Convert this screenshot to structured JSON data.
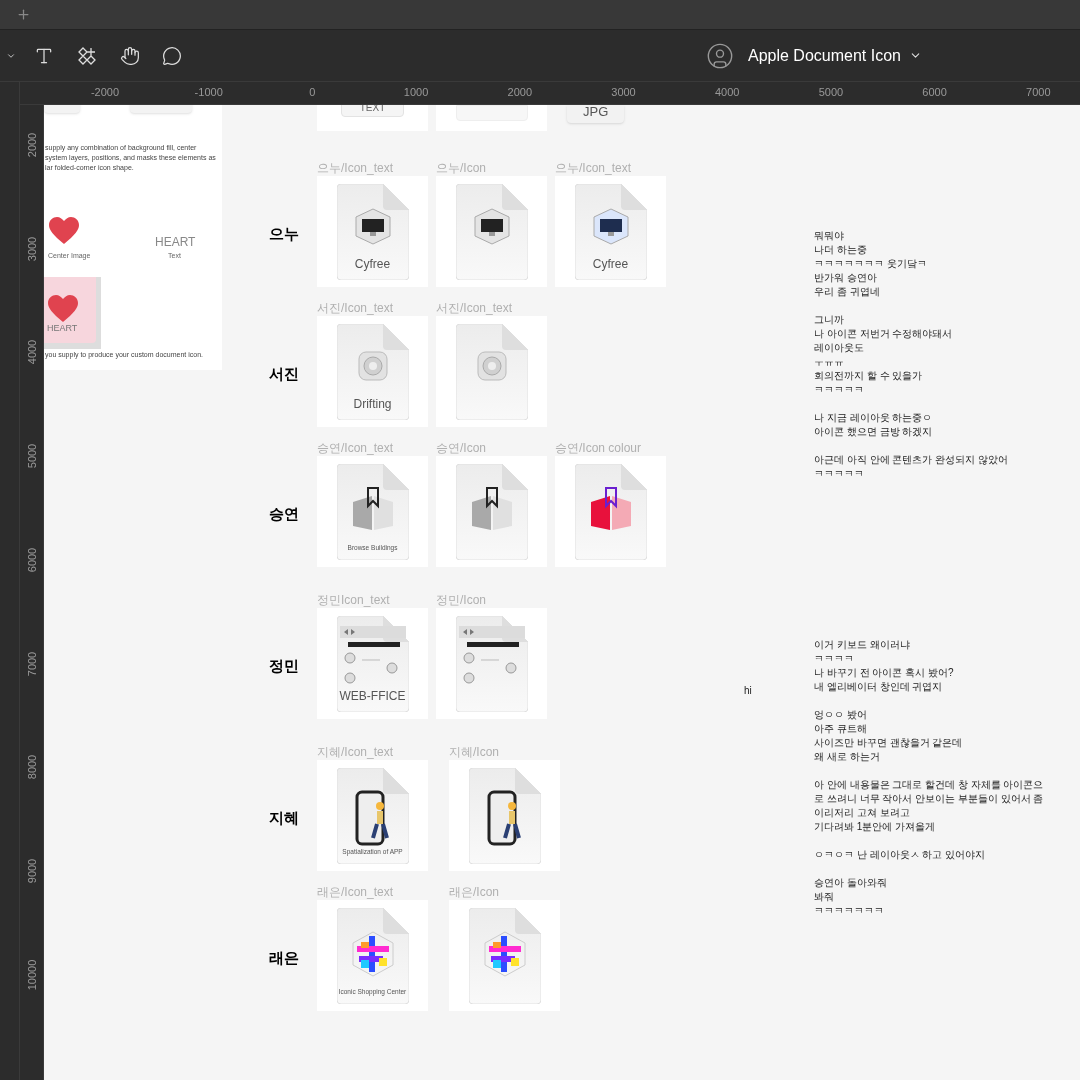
{
  "toolbar": {
    "file_title": "Apple Document Icon"
  },
  "ruler": {
    "x_ticks": [
      "-2000",
      "-1000",
      "0",
      "1000",
      "2000",
      "3000",
      "4000",
      "5000",
      "6000",
      "7000"
    ],
    "y_ticks": [
      "2000",
      "3000",
      "4000",
      "5000",
      "6000",
      "7000",
      "8000",
      "9000",
      "10000"
    ]
  },
  "doc_frame": {
    "paragraph": [
      "supply any combination of background fill, center",
      "system layers, positions, and masks these elements as",
      "lar folded-corner icon shape."
    ],
    "center_label": "Center Image",
    "text_sample": "HEART",
    "text_label": "Text",
    "icon_caption": "HEART",
    "footnote": "you supply to produce your custom document icon."
  },
  "top_row": {
    "captions": [
      "TEXT",
      "JPG"
    ]
  },
  "rows": [
    {
      "name": "으누",
      "cells": [
        {
          "label": "으누/Icon_text",
          "caption": "Cyfree"
        },
        {
          "label": "으누/Icon"
        },
        {
          "label": "으누/Icon_text",
          "caption": "Cyfree"
        }
      ]
    },
    {
      "name": "서진",
      "cells": [
        {
          "label": "서진/Icon_text",
          "caption": "Drifting"
        },
        {
          "label": "서진/Icon_text"
        }
      ]
    },
    {
      "name": "승연",
      "cells": [
        {
          "label": "승연/Icon_text",
          "caption": "Browse Buildings"
        },
        {
          "label": "승연/Icon"
        },
        {
          "label": "승연/Icon colour"
        }
      ]
    },
    {
      "name": "정민",
      "cells": [
        {
          "label": "정민Icon_text",
          "caption": "WEB-FFICE"
        },
        {
          "label": "정민/Icon"
        }
      ]
    },
    {
      "name": "지혜",
      "cells": [
        {
          "label": "지혜/Icon_text",
          "caption": "Spatialization of APP"
        },
        {
          "label": "지혜/Icon"
        }
      ]
    },
    {
      "name": "래은",
      "cells": [
        {
          "label": "래은/Icon_text",
          "caption": "Iconic Shopping Center"
        },
        {
          "label": "래은/Icon"
        }
      ]
    }
  ],
  "notes": [
    {
      "paragraphs": [
        [
          "뭐뭐야",
          "나더 하는중",
          "ㅋㅋㅋㅋㅋㅋㅋ 웃기닼ㅋ",
          "반가워 승연아",
          "우리 좀 귀엽네"
        ],
        [
          "그니까",
          "나 아이콘 저번거 수정해야돼서",
          "레이아웃도",
          "ㅜㅠㅠ",
          "회의전까지 할 수 있을가",
          "ㅋㅋㅋㅋㅋ"
        ],
        [
          "나 지금 레이아웃 하는중ㅇ",
          "아이콘 했으면 금방 하겠지"
        ],
        [
          "아근데 아직 안에 콘텐츠가 완성되지 않았어",
          "ㅋㅋㅋㅋㅋ"
        ]
      ]
    },
    {
      "paragraphs": [
        [
          "이거 키보드 왜이러냐",
          "ㅋㅋㅋㅋ",
          "나 바꾸기 전 아이콘 혹시 봤어?",
          "내 엘리베이터 창인데 귀엽지"
        ],
        [
          "엉ㅇㅇ 봤어",
          "아주 큐트해",
          "사이즈만 바꾸면 괜찮을거 같은데",
          "왜 새로 하는거"
        ],
        [
          "아 안에 내용물은 그대로 할건데 창 자체를 아이콘으로 쓰려니 너무 작아서 안보이는 부분들이 있어서 좀",
          "이리저리 고쳐 보려고",
          "기다려봐 1분안에 가져올게"
        ],
        [
          "ㅇㅋㅇㅋ 난 레이아웃ㅅ 하고 있어야지"
        ],
        [
          "승연아 돌아와줘",
          "봐줘",
          "ㅋㅋㅋㅋㅋㅋㅋ"
        ]
      ]
    }
  ],
  "stray_note": "hi"
}
